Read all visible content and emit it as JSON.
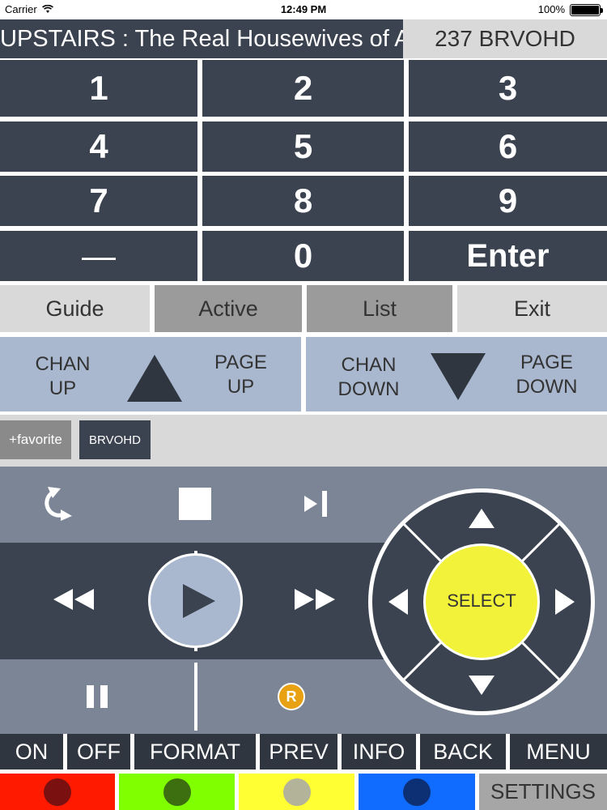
{
  "status_bar": {
    "carrier": "Carrier",
    "time": "12:49 PM",
    "battery": "100%"
  },
  "now_playing": {
    "text": "UPSTAIRS : The Real Housewives of Atl",
    "channel": "237 BRVOHD"
  },
  "keypad": {
    "keys": [
      "1",
      "2",
      "3",
      "4",
      "5",
      "6",
      "7",
      "8",
      "9",
      "—",
      "0",
      "Enter"
    ]
  },
  "menu": {
    "guide": "Guide",
    "active": "Active",
    "list": "List",
    "exit": "Exit"
  },
  "channel_controls": {
    "chan_up_line1": "CHAN",
    "chan_up_line2": "UP",
    "page_up_line1": "PAGE",
    "page_up_line2": "UP",
    "chan_down_line1": "CHAN",
    "chan_down_line2": "DOWN",
    "page_down_line1": "PAGE",
    "page_down_line2": "DOWN"
  },
  "favorites": {
    "add_label": "+favorite",
    "items": [
      "BRVOHD"
    ]
  },
  "dpad": {
    "select_label": "SELECT"
  },
  "record_badge": "R",
  "bottom_row": {
    "on": "ON",
    "off": "OFF",
    "format": "FORMAT",
    "prev": "PREV",
    "info": "INFO",
    "back": "BACK",
    "menu": "MENU"
  },
  "color_row": {
    "buttons": [
      {
        "name": "red",
        "bg": "#ff1a00",
        "dot": "#7a1010"
      },
      {
        "name": "green",
        "bg": "#80ff00",
        "dot": "#3d6f10"
      },
      {
        "name": "yellow",
        "bg": "#ffff33",
        "dot": "#b3b39a"
      },
      {
        "name": "blue",
        "bg": "#0f6cff",
        "dot": "#0d2f73"
      }
    ],
    "settings": "SETTINGS"
  },
  "colors": {
    "dark": "#3b4350",
    "mid": "#7b8596",
    "light": "#a9b8cf",
    "select": "#f2f23a"
  }
}
